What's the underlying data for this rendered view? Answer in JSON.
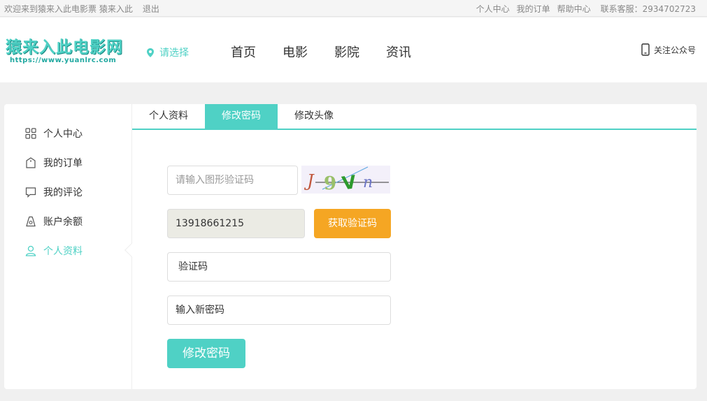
{
  "topbar": {
    "welcome": "欢迎来到猿来入此电影票 猿来入此",
    "logout": "退出",
    "links": [
      "个人中心",
      "我的订单",
      "帮助中心"
    ],
    "service": "联系客服：2934702723"
  },
  "header": {
    "logo_main": "猿来入此电影网",
    "logo_sub": "https://www.yuanlrc.com",
    "city_placeholder": "请选择",
    "nav": [
      "首页",
      "电影",
      "影院",
      "资讯"
    ],
    "follow": "关注公众号"
  },
  "sidebar": {
    "items": [
      {
        "label": "个人中心",
        "icon": "grid-icon"
      },
      {
        "label": "我的订单",
        "icon": "tag-icon"
      },
      {
        "label": "我的评论",
        "icon": "comment-icon"
      },
      {
        "label": "账户余额",
        "icon": "wallet-icon"
      },
      {
        "label": "个人资料",
        "icon": "user-icon"
      }
    ],
    "active_index": 4
  },
  "tabs": [
    "个人资料",
    "修改密码",
    "修改头像"
  ],
  "active_tab": 1,
  "form": {
    "captcha_placeholder": "请输入图形验证码",
    "captcha_text": "J9Vn",
    "phone_value": "13918661215",
    "get_code_button": "获取验证码",
    "code_placeholder": "验证码",
    "new_password_placeholder": "输入新密码",
    "submit_button": "修改密码"
  },
  "colors": {
    "accent": "#4fd1c5",
    "orange": "#f5a623"
  }
}
